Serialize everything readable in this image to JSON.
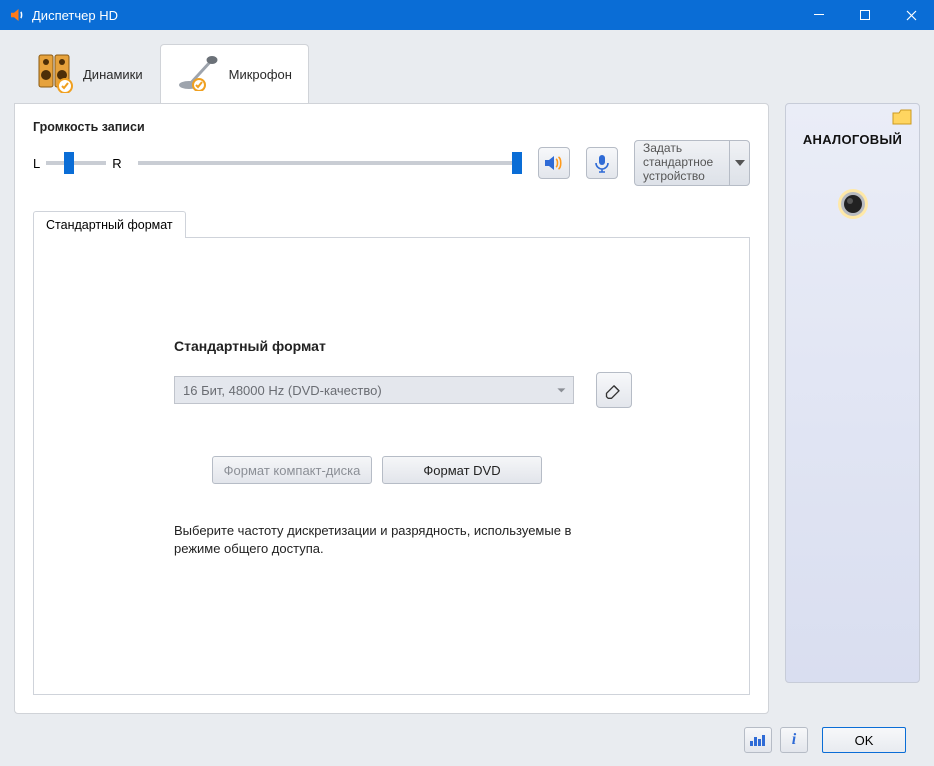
{
  "window": {
    "title": "Диспетчер HD"
  },
  "deviceTabs": {
    "speakers": "Динамики",
    "microphone": "Микрофон"
  },
  "recording": {
    "title": "Громкость записи",
    "left": "L",
    "right": "R",
    "default_label": "Задать стандартное устройство"
  },
  "format": {
    "tab_label": "Стандартный формат",
    "heading": "Стандартный формат",
    "selected": "16 Бит, 48000 Hz (DVD-качество)",
    "cd_button": "Формат компакт-диска",
    "dvd_button": "Формат DVD",
    "hint": "Выберите частоту дискретизации и разрядность, используемые в режиме общего доступа."
  },
  "side": {
    "label": "АНАЛОГОВЫЙ"
  },
  "footer": {
    "ok": "OK"
  }
}
